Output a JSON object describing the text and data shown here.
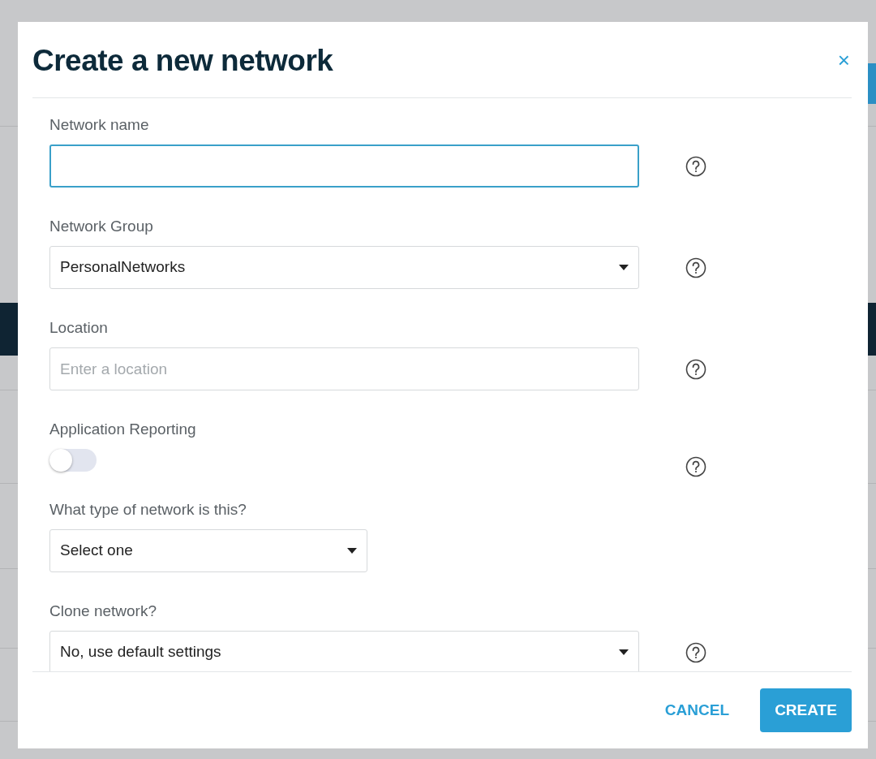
{
  "dialog": {
    "title": "Create a new network",
    "close_label": "×"
  },
  "fields": [
    {
      "kind": "text",
      "label": "Network name",
      "focused": true,
      "help": true
    },
    {
      "kind": "select",
      "label": "Network Group",
      "value": "PersonalNetworks",
      "wide": true,
      "help": true
    },
    {
      "kind": "text",
      "label": "Location",
      "placeholder": "Enter a location",
      "focused": false,
      "help": true
    },
    {
      "kind": "toggle",
      "label": "Application Reporting",
      "on": false,
      "help": true
    },
    {
      "kind": "select",
      "label": "What type of network is this?",
      "value": "Select one",
      "wide": false,
      "help": false
    },
    {
      "kind": "select",
      "label": "Clone network?",
      "value": "No, use default settings",
      "wide": true,
      "help": true
    }
  ],
  "buttons": [
    {
      "label": "CANCEL",
      "kind": "link"
    },
    {
      "label": "CREATE",
      "kind": "primary"
    }
  ]
}
